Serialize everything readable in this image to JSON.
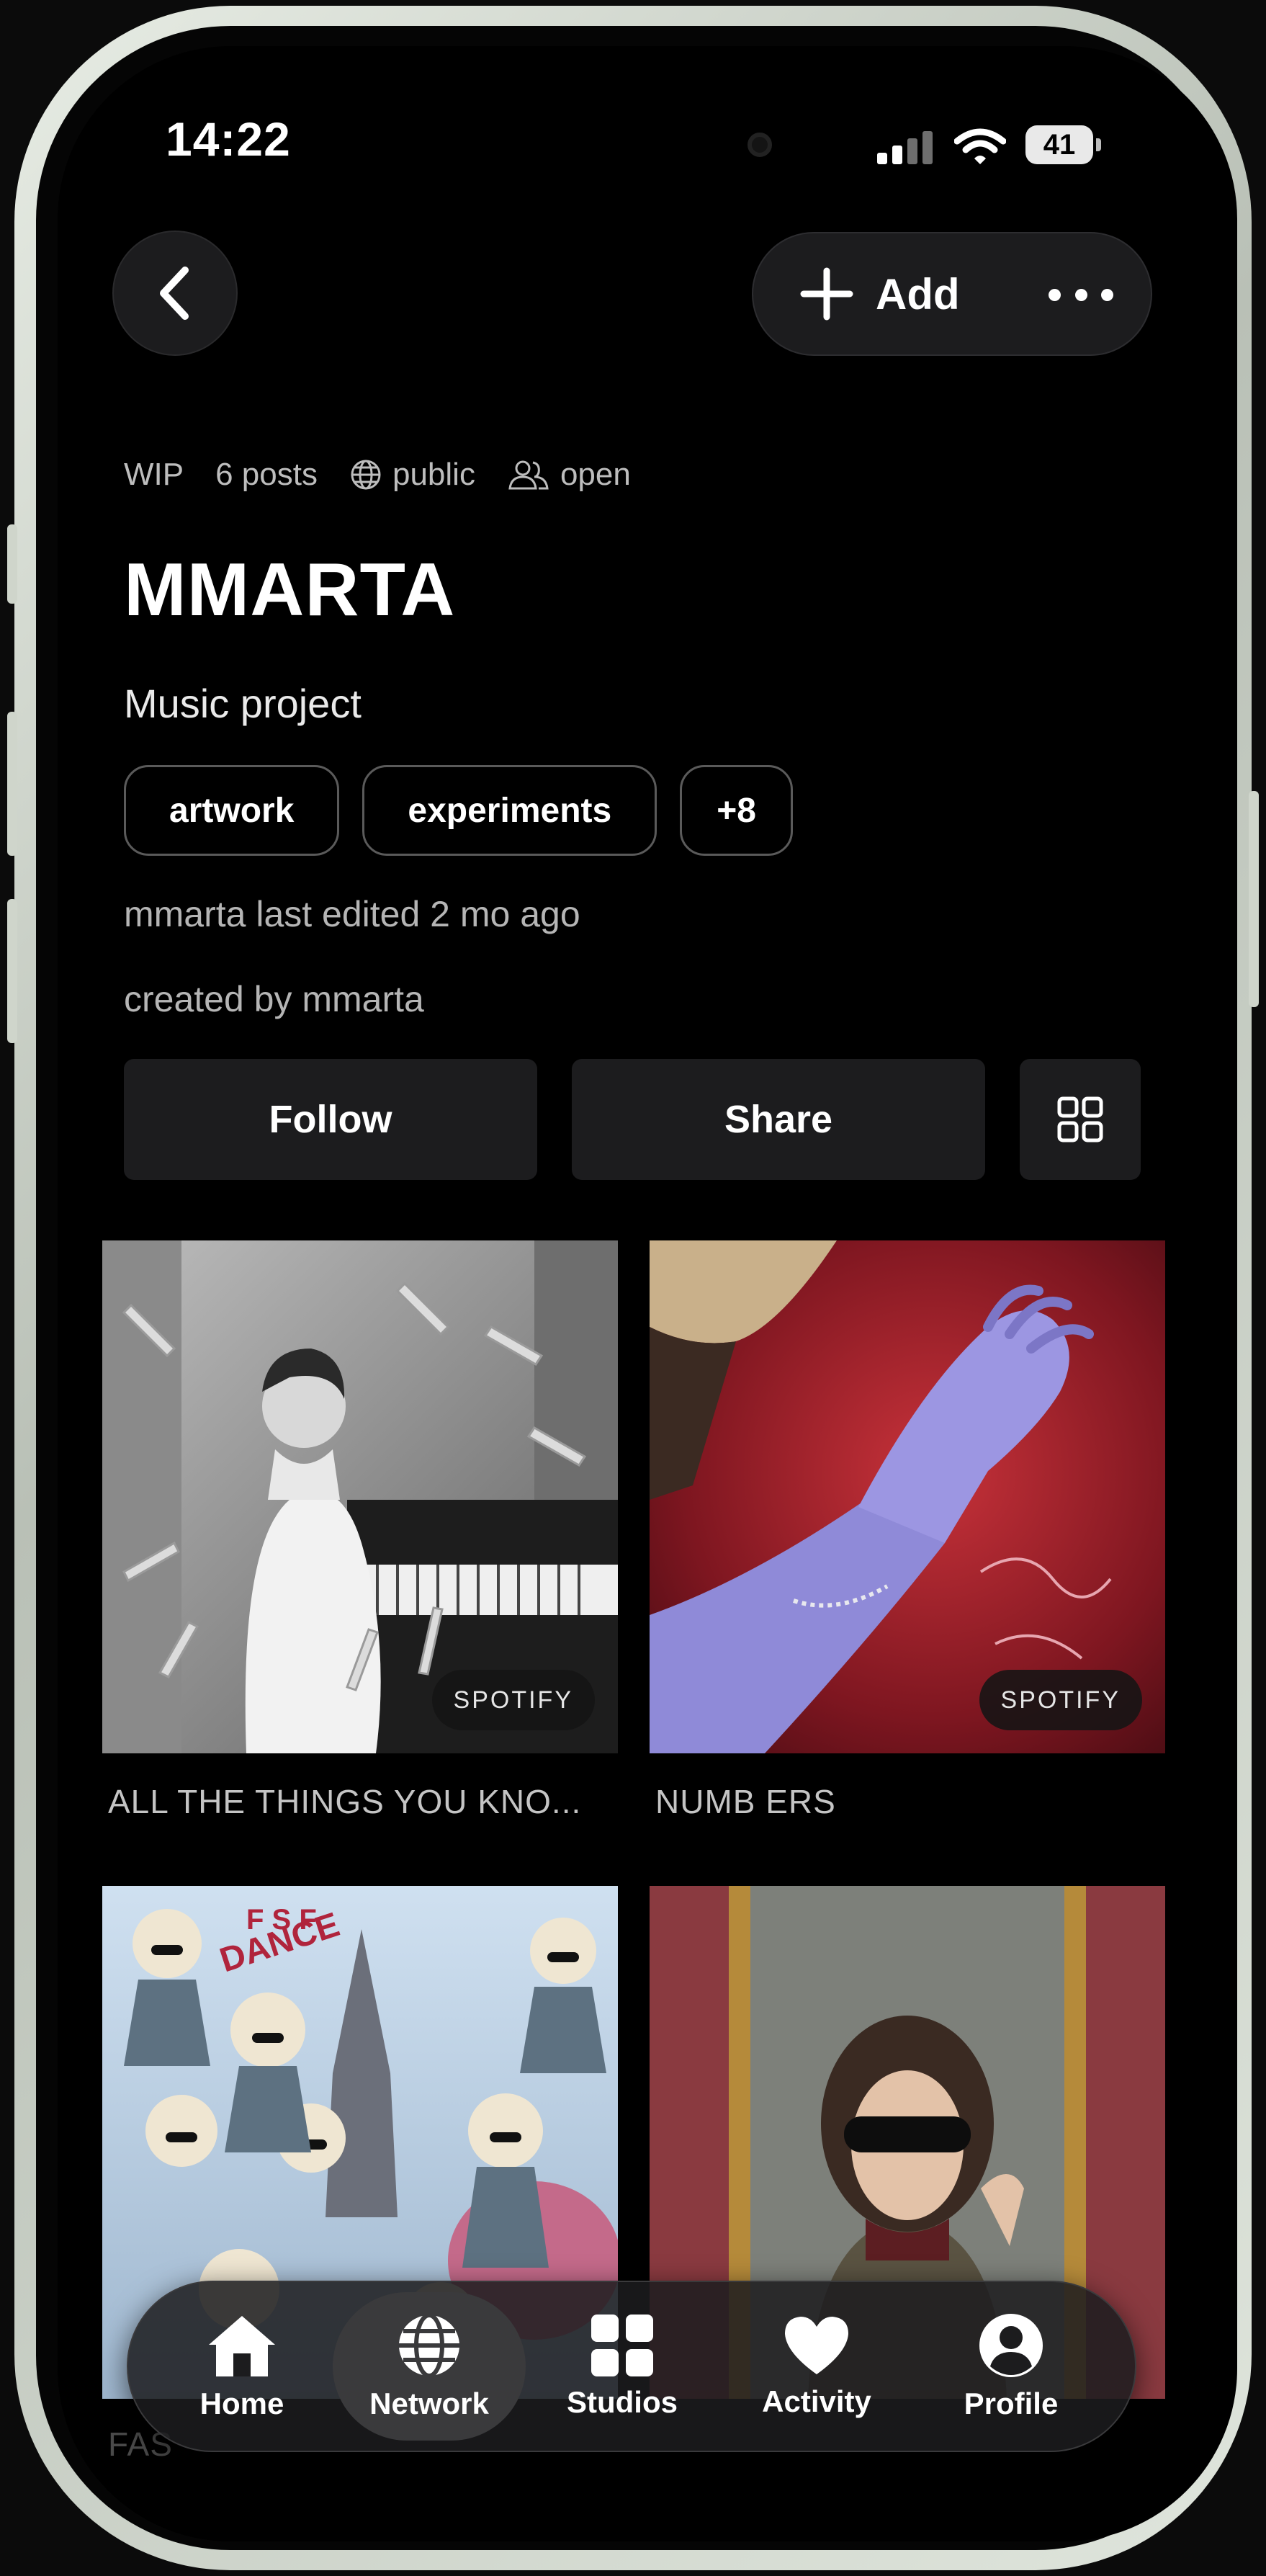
{
  "status_bar": {
    "time": "14:22",
    "battery": "41"
  },
  "header": {
    "add_label": "Add"
  },
  "meta": {
    "status": "WIP",
    "posts": "6 posts",
    "visibility": "public",
    "membership": "open"
  },
  "project": {
    "title": "MMARTA",
    "description": "Music project",
    "tags": [
      "artwork",
      "experiments",
      "+8"
    ],
    "last_edited": "mmarta last edited 2 mo ago",
    "created_by": "created by mmarta"
  },
  "actions": {
    "follow": "Follow",
    "share": "Share"
  },
  "posts": [
    {
      "title": "ALL THE THINGS YOU KNO...",
      "source": "SPOTIFY"
    },
    {
      "title": "NUMB ERS",
      "source": "SPOTIFY"
    },
    {
      "title": "FAS",
      "source": ""
    },
    {
      "title": "",
      "source": ""
    }
  ],
  "post_art_text": {
    "poster_letters": "DANCE",
    "poster_letters_2": "F S F"
  },
  "tabbar": {
    "active": "Network",
    "items": [
      {
        "label": "Home",
        "icon": "home-icon"
      },
      {
        "label": "Network",
        "icon": "globe-icon"
      },
      {
        "label": "Studios",
        "icon": "grid-icon"
      },
      {
        "label": "Activity",
        "icon": "heart-icon"
      },
      {
        "label": "Profile",
        "icon": "profile-icon"
      }
    ]
  },
  "colors": {
    "background": "#000000",
    "surface": "#1c1c1e",
    "tab_active": "#3a3a3c",
    "frame": "#dfe5dc"
  }
}
